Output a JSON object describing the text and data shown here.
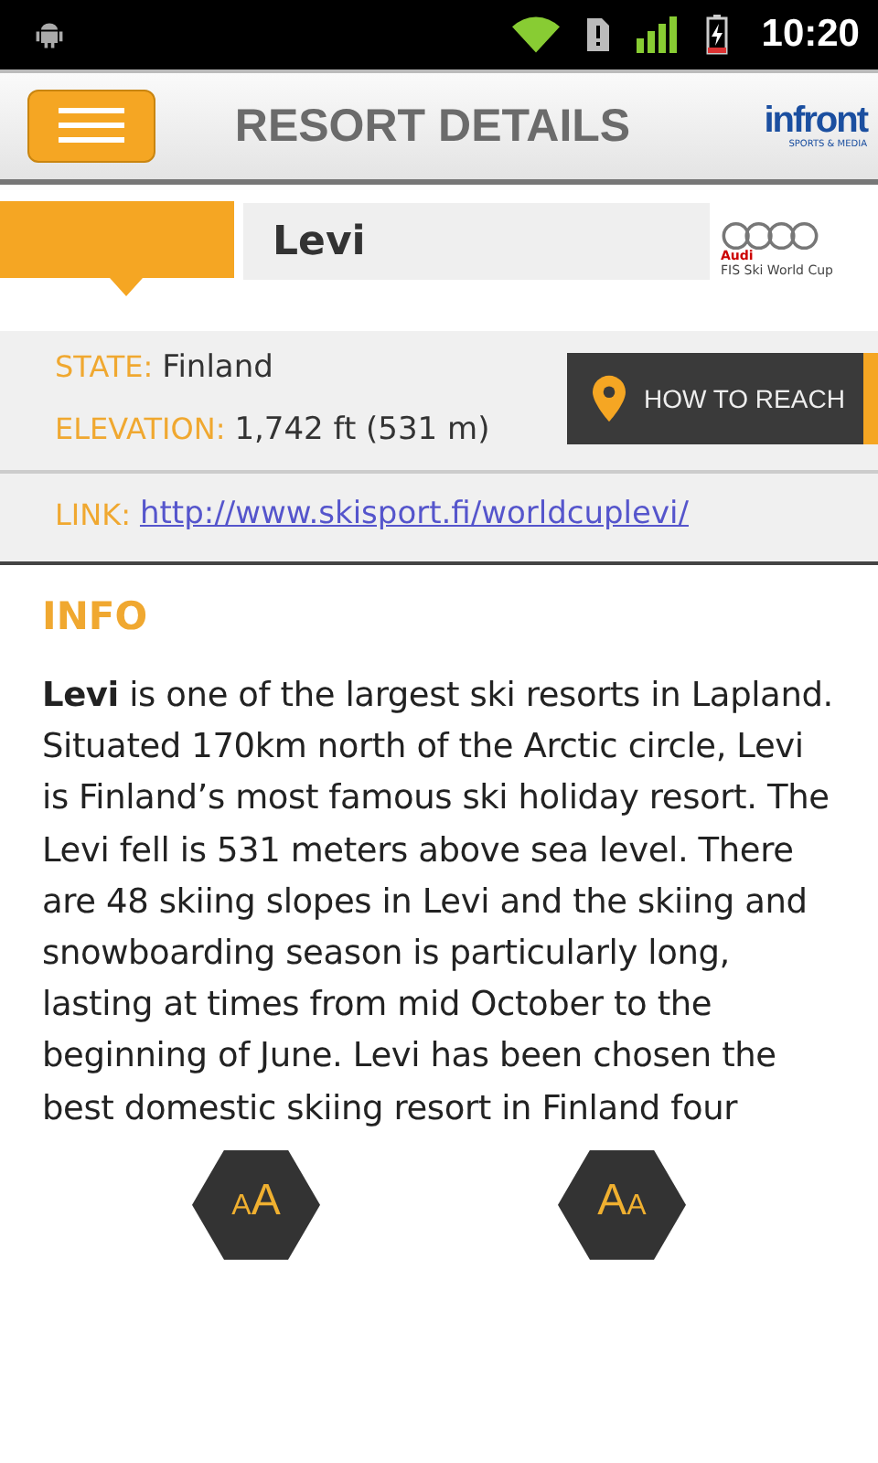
{
  "status_bar": {
    "time": "10:20"
  },
  "header": {
    "title": "RESORT DETAILS",
    "logo": {
      "name": "infront",
      "tagline": "SPORTS & MEDIA"
    }
  },
  "resort": {
    "name": "Levi",
    "sponsor": {
      "brand": "Audi",
      "event": "FIS Ski World Cup"
    }
  },
  "details": [
    {
      "label": "STATE:",
      "value": "Finland"
    },
    {
      "label": "ELEVATION:",
      "value": "1,742 ft (531 m)"
    }
  ],
  "reach_button": {
    "label": "HOW TO REACH"
  },
  "link": {
    "label": "LINK:",
    "url": "http://www.skisport.fi/worldcuplevi/"
  },
  "info": {
    "title": "INFO",
    "text": "**Levi** is one of the largest ski resorts in Lapland. Situated 170km north of the Arctic circle, Levi is Finland’s most famous ski holiday resort. The Levi fell is 531 meters above sea level. There are 48 skiing slopes in Levi and the skiing and snowboarding season is particularly long, lasting at times from mid October to the beginning of June. Levi has been chosen the best domestic skiing resort in Finland four"
  },
  "font_buttons": [
    {
      "parts": [
        {
          "text": "A",
          "kind": "small"
        },
        {
          "text": "A",
          "kind": "large"
        }
      ]
    },
    {
      "parts": [
        {
          "text": "A",
          "kind": "large"
        },
        {
          "text": "A",
          "kind": "small"
        }
      ]
    }
  ]
}
